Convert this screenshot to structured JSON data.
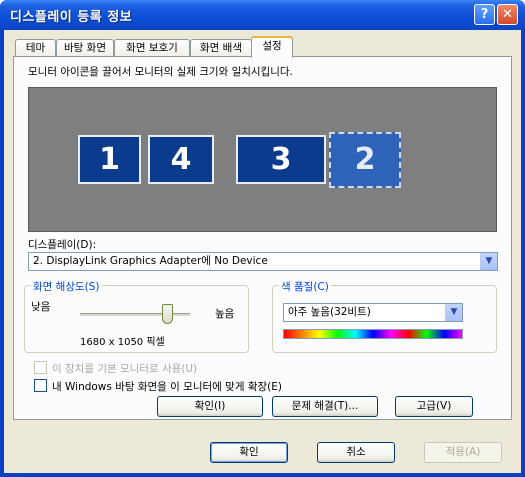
{
  "window": {
    "title": "디스플레이 등록 정보",
    "help": "?",
    "close": "✕"
  },
  "tabs": [
    {
      "label": "테마"
    },
    {
      "label": "바탕 화면"
    },
    {
      "label": "화면 보호기"
    },
    {
      "label": "화면 배색"
    },
    {
      "label": "설정"
    }
  ],
  "settings": {
    "instruction": "모니터 아이콘을 끌어서 모니터의 실제 크기와 일치시킵니다.",
    "monitors": [
      {
        "number": "1",
        "selected": false
      },
      {
        "number": "4",
        "selected": false
      },
      {
        "number": "3",
        "selected": false
      },
      {
        "number": "2",
        "selected": true
      }
    ],
    "display_label": "디스플레이(D):",
    "display_value": "2. DisplayLink Graphics Adapter에 No Device",
    "resolution": {
      "title": "화면 해상도(S)",
      "low": "낮음",
      "high": "높음",
      "value_text": "1680 x 1050 픽셀",
      "slider_level": 0.75
    },
    "color_quality": {
      "title": "색 품질(C)",
      "value": "아주 높음(32비트)"
    },
    "primary_monitor_checkbox": {
      "label": "이 장치를 기본 모니터로 사용(U)",
      "checked": false,
      "enabled": false
    },
    "extend_checkbox": {
      "label": "내 Windows 바탕 화면을 이 모니터에 맞게 확장(E)",
      "checked": false,
      "enabled": true
    },
    "identify_button": "확인(I)",
    "troubleshoot_button": "문제 해결(T)...",
    "advanced_button": "고급(V)"
  },
  "footer": {
    "ok": "확인",
    "cancel": "취소",
    "apply": "적용(A)"
  },
  "colors": {
    "title_bar": "#0d4fd8",
    "monitor_area": "#7f7f7f",
    "monitor_fill": "#0b3b8c",
    "group_title": "#0046d5"
  }
}
